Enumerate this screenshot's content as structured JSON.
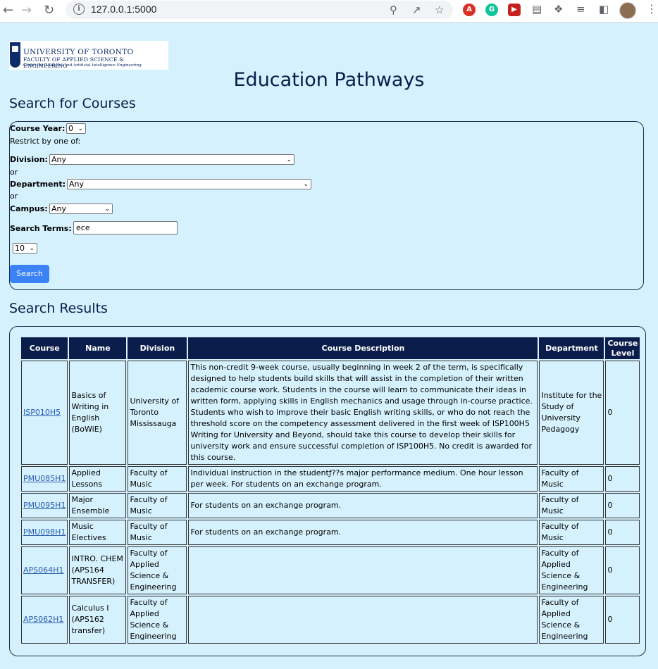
{
  "browser": {
    "url": "127.0.0.1:5000"
  },
  "header": {
    "logo": {
      "line1": "UNIVERSITY OF TORONTO",
      "line2": "FACULTY OF APPLIED SCIENCE & ENGINEERING",
      "line3": "Centre for Analytics and Artificial Intelligence Engineering"
    },
    "title": "Education Pathways"
  },
  "search": {
    "heading": "Search for Courses",
    "course_year_label": "Course Year:",
    "course_year_value": "0",
    "restrict_text": "Restrict by one of:",
    "division_label": "Division:",
    "division_value": "Any",
    "or1": "or",
    "department_label": "Department:",
    "department_value": "Any",
    "or2": "or",
    "campus_label": "Campus:",
    "campus_value": "Any",
    "terms_label": "Search Terms:",
    "terms_value": "ece",
    "limit_value": "10",
    "button_label": "Search"
  },
  "results": {
    "heading": "Search Results",
    "columns": [
      "Course",
      "Name",
      "Division",
      "Course Description",
      "Department",
      "Course Level"
    ],
    "rows": [
      {
        "course": "ISP010H5",
        "name": "Basics of Writing in English (BoWiE)",
        "division": "University of Toronto Mississauga",
        "description": "This non-credit 9-week course, usually beginning in week 2 of the term, is specifically designed to help students build skills that will assist in the completion of their written academic course work. Students in the course will learn to communicate their ideas in written form, applying skills in English mechanics and usage through in-course practice. Students who wish to improve their basic English writing skills, or who do not reach the threshold score on the competency assessment delivered in the first week of ISP100H5 Writing for University and Beyond, should take this course to develop their skills for university work and ensure successful completion of ISP100H5. No credit is awarded for this course.",
        "department": "Institute for the Study of University Pedagogy",
        "level": "0"
      },
      {
        "course": "PMU085H1",
        "name": "Applied Lessons",
        "division": "Faculty of Music",
        "description": "Individual instruction in the studentƒ??s major performance medium. One hour lesson per week. For students on an exchange program.",
        "department": "Faculty of Music",
        "level": "0"
      },
      {
        "course": "PMU095H1",
        "name": "Major Ensemble",
        "division": "Faculty of Music",
        "description": "For students on an exchange program.",
        "department": "Faculty of Music",
        "level": "0"
      },
      {
        "course": "PMU098H1",
        "name": "Music Electives",
        "division": "Faculty of Music",
        "description": "For students on an exchange program.",
        "department": "Faculty of Music",
        "level": "0"
      },
      {
        "course": "APS064H1",
        "name": "INTRO. CHEM (APS164 TRANSFER)",
        "division": "Faculty of Applied Science & Engineering",
        "description": "",
        "department": "Faculty of Applied Science & Engineering",
        "level": "0"
      },
      {
        "course": "APS062H1",
        "name": "Calculus I (APS162 transfer)",
        "division": "Faculty of Applied Science & Engineering",
        "description": "",
        "department": "Faculty of Applied Science & Engineering",
        "level": "0"
      }
    ]
  },
  "colors": {
    "page_bg": "#d5f1fd",
    "header_navy": "#0b1d4a",
    "button_blue": "#3b82f6",
    "link_blue": "#2a5db0"
  }
}
